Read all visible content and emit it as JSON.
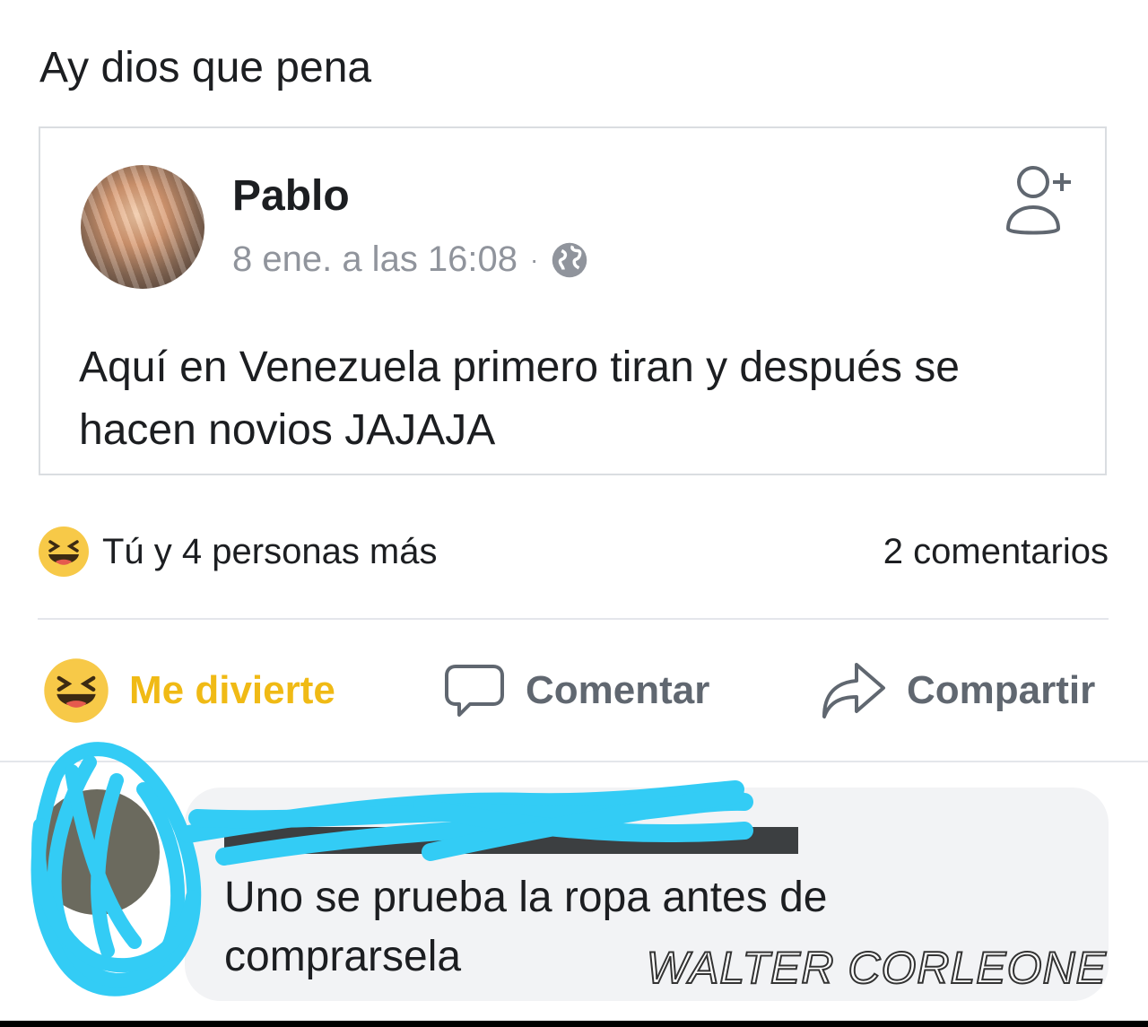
{
  "post": {
    "text": "Ay dios que pena"
  },
  "shared_post": {
    "author": "Pablo",
    "timestamp": "8 ene. a las 16:08",
    "separator": "·",
    "privacy_icon": "globe-icon",
    "add_friend_icon": "add-friend-icon",
    "body": "Aquí en Venezuela primero tiran y después se hacen novios JAJAJA"
  },
  "reactions": {
    "emoji": "haha-emoji",
    "summary": "Tú y 4 personas más",
    "comments_count": "2 comentarios"
  },
  "actions": {
    "react_label": "Me divierte",
    "comment_label": "Comentar",
    "share_label": "Compartir"
  },
  "comment": {
    "author_obscured": true,
    "text": "Uno se prueba la ropa antes de comprarsela"
  },
  "watermark": "WALTER CORLEONE",
  "colors": {
    "reaction_accent": "#f0ba15",
    "scribble": "#33ccf5",
    "muted_text": "#90949c"
  }
}
